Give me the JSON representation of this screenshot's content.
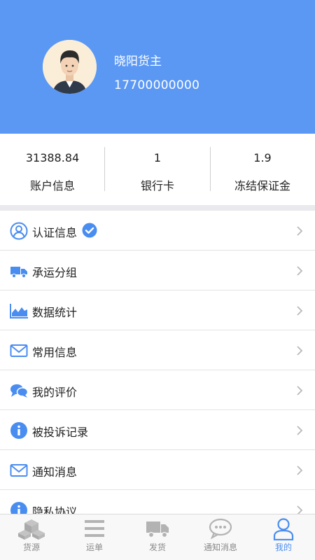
{
  "profile": {
    "name": "晓阳货主",
    "phone": "17700000000"
  },
  "stats": [
    {
      "value": "31388.84",
      "label": "账户信息"
    },
    {
      "value": "1",
      "label": "银行卡"
    },
    {
      "value": "1.9",
      "label": "冻结保证金"
    }
  ],
  "menu": [
    {
      "label": "认证信息",
      "icon": "user-circle-icon",
      "verified": true
    },
    {
      "label": "承运分组",
      "icon": "truck-icon"
    },
    {
      "label": "数据统计",
      "icon": "area-chart-icon"
    },
    {
      "label": "常用信息",
      "icon": "envelope-icon"
    },
    {
      "label": "我的评价",
      "icon": "chat-bubbles-icon"
    },
    {
      "label": "被投诉记录",
      "icon": "info-icon"
    },
    {
      "label": "通知消息",
      "icon": "envelope-icon"
    },
    {
      "label": "隐私协议",
      "icon": "info-icon"
    }
  ],
  "tabs": [
    {
      "label": "货源",
      "icon": "boxes-icon",
      "active": false
    },
    {
      "label": "运单",
      "icon": "list-icon",
      "active": false
    },
    {
      "label": "发货",
      "icon": "truck-icon",
      "active": false
    },
    {
      "label": "通知消息",
      "icon": "chat-icon",
      "active": false
    },
    {
      "label": "我的",
      "icon": "person-icon",
      "active": true
    }
  ],
  "colors": {
    "header": "#5b98f4",
    "accent": "#4a8df0",
    "icon": "#4a8df0",
    "tab_inactive": "#8a8a8a"
  }
}
